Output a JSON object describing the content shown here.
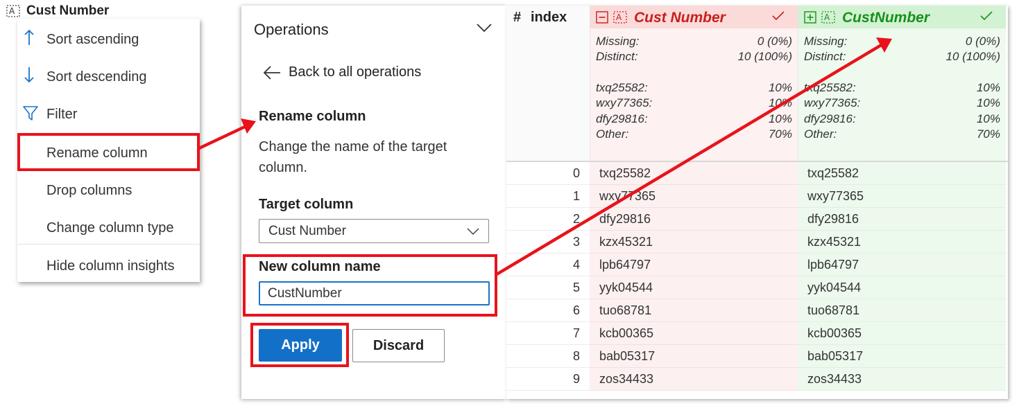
{
  "column_header": {
    "title": "Cust Number",
    "icon": "text-column-icon"
  },
  "context_menu": {
    "items": [
      {
        "label": "Sort ascending",
        "icon": "arrow-up-icon"
      },
      {
        "label": "Sort descending",
        "icon": "arrow-down-icon"
      },
      {
        "label": "Filter",
        "icon": "filter-icon"
      },
      {
        "label": "Rename column",
        "icon": "",
        "highlighted": true
      },
      {
        "label": "Drop columns",
        "icon": ""
      },
      {
        "label": "Change column type",
        "icon": ""
      },
      {
        "label": "Hide column insights",
        "icon": ""
      }
    ]
  },
  "operations": {
    "title": "Operations",
    "back_label": "Back to all operations",
    "section_title": "Rename column",
    "description": "Change the name of the target column.",
    "target_label": "Target column",
    "target_value": "Cust Number",
    "new_name_label": "New column name",
    "new_name_value": "CustNumber",
    "apply_label": "Apply",
    "discard_label": "Discard"
  },
  "grid": {
    "index_hash": "#",
    "index_label": "index",
    "old_column": {
      "name": "Cust Number",
      "missing_label": "Missing:",
      "missing_value": "0 (0%)",
      "distinct_label": "Distinct:",
      "distinct_value": "10 (100%)",
      "top_values": [
        {
          "label": "txq25582:",
          "value": "10%"
        },
        {
          "label": "wxy77365:",
          "value": "10%"
        },
        {
          "label": "dfy29816:",
          "value": "10%"
        },
        {
          "label": "Other:",
          "value": "70%"
        }
      ]
    },
    "new_column": {
      "name": "CustNumber",
      "missing_label": "Missing:",
      "missing_value": "0 (0%)",
      "distinct_label": "Distinct:",
      "distinct_value": "10 (100%)",
      "top_values": [
        {
          "label": "txq25582:",
          "value": "10%"
        },
        {
          "label": "wxy77365:",
          "value": "10%"
        },
        {
          "label": "dfy29816:",
          "value": "10%"
        },
        {
          "label": "Other:",
          "value": "70%"
        }
      ]
    },
    "rows": [
      {
        "index": "0",
        "old": "txq25582",
        "new": "txq25582"
      },
      {
        "index": "1",
        "old": "wxy77365",
        "new": "wxy77365"
      },
      {
        "index": "2",
        "old": "dfy29816",
        "new": "dfy29816"
      },
      {
        "index": "3",
        "old": "kzx45321",
        "new": "kzx45321"
      },
      {
        "index": "4",
        "old": "lpb64797",
        "new": "lpb64797"
      },
      {
        "index": "5",
        "old": "yyk04544",
        "new": "yyk04544"
      },
      {
        "index": "6",
        "old": "tuo68781",
        "new": "tuo68781"
      },
      {
        "index": "7",
        "old": "kcb00365",
        "new": "kcb00365"
      },
      {
        "index": "8",
        "old": "bab05317",
        "new": "bab05317"
      },
      {
        "index": "9",
        "old": "zos34433",
        "new": "zos34433"
      }
    ]
  },
  "colors": {
    "highlight_red": "#e8131b",
    "apply_blue": "#1370c8",
    "removed_red": "#c81e1e",
    "added_green": "#17901a"
  }
}
